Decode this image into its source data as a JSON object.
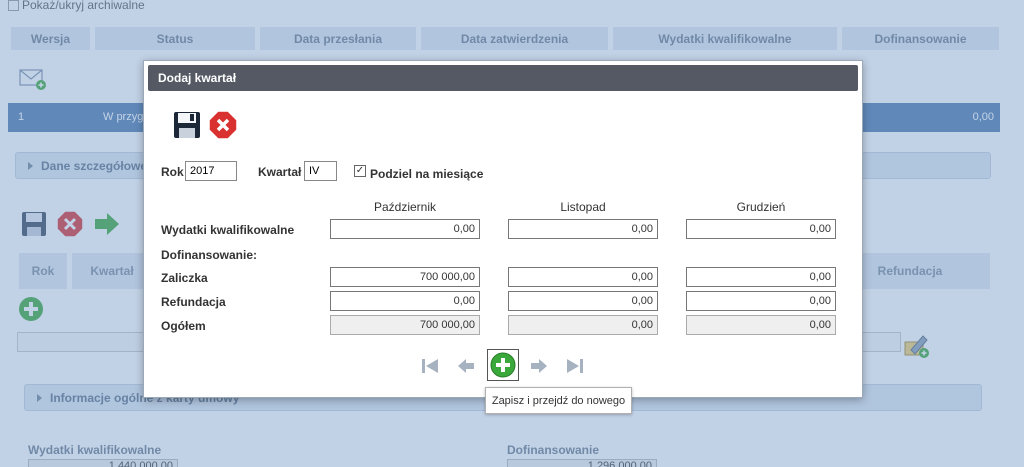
{
  "background": {
    "archive_toggle": "Pokaż/ukryj archiwalne",
    "table_headers": [
      "Wersja",
      "Status",
      "Data przesłania",
      "Data zatwierdzenia",
      "Wydatki kwalifikowalne",
      "Dofinansowanie"
    ],
    "row": {
      "num": "1",
      "status": "W przyg",
      "value": "0,00"
    },
    "section_details": "Dane szczegółowe",
    "sub_headers": {
      "rok": "Rok",
      "kwartal": "Kwartał",
      "refundacja": "Refundacja"
    },
    "section_info": "Informacje ogólne z karty umowy",
    "bottom": {
      "wydatki_label": "Wydatki kwalifikowalne",
      "wydatki_value": "1 440 000,00",
      "dofin_label": "Dofinansowanie",
      "dofin_value": "1 296 000,00"
    }
  },
  "dialog": {
    "title": "Dodaj kwartał",
    "rok_label": "Rok",
    "rok_value": "2017",
    "kwartal_label": "Kwartał",
    "kwartal_value": "IV",
    "podzial_label": "Podziel na miesiące",
    "podzial_checked": "✓",
    "months": [
      "Październik",
      "Listopad",
      "Grudzień"
    ],
    "rows": {
      "wydatki_label": "Wydatki kwalifikowalne",
      "wydatki_values": [
        "0,00",
        "0,00",
        "0,00"
      ],
      "dofin_label": "Dofinansowanie:",
      "zaliczka_label": "Zaliczka",
      "zaliczka_values": [
        "700 000,00",
        "0,00",
        "0,00"
      ],
      "refundacja_label": "Refundacja",
      "refundacja_values": [
        "0,00",
        "0,00",
        "0,00"
      ],
      "ogolem_label": "Ogółem",
      "ogolem_values": [
        "700 000,00",
        "0,00",
        "0,00"
      ]
    },
    "tooltip": "Zapisz i przejdź do nowego"
  },
  "colors": {
    "accent": "#4e7bb0",
    "title_bar": "#545964",
    "add_green": "#3aa83a",
    "cancel_red": "#d93030"
  }
}
